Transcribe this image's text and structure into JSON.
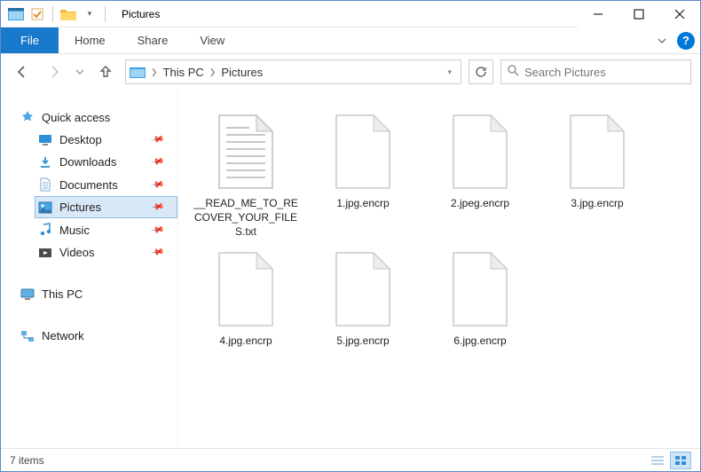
{
  "window": {
    "title": "Pictures"
  },
  "ribbon": {
    "file": "File",
    "tabs": [
      "Home",
      "Share",
      "View"
    ]
  },
  "breadcrumb": {
    "items": [
      "This PC",
      "Pictures"
    ]
  },
  "search": {
    "placeholder": "Search Pictures"
  },
  "sidebar": {
    "quick_access": "Quick access",
    "quick_items": [
      {
        "label": "Desktop",
        "icon": "desktop"
      },
      {
        "label": "Downloads",
        "icon": "downloads"
      },
      {
        "label": "Documents",
        "icon": "documents"
      },
      {
        "label": "Pictures",
        "icon": "pictures",
        "selected": true
      },
      {
        "label": "Music",
        "icon": "music"
      },
      {
        "label": "Videos",
        "icon": "videos"
      }
    ],
    "this_pc": "This PC",
    "network": "Network"
  },
  "files": [
    {
      "name": "__READ_ME_TO_RECOVER_YOUR_FILES.txt",
      "type": "txt"
    },
    {
      "name": "1.jpg.encrp",
      "type": "blank"
    },
    {
      "name": "2.jpeg.encrp",
      "type": "blank"
    },
    {
      "name": "3.jpg.encrp",
      "type": "blank"
    },
    {
      "name": "4.jpg.encrp",
      "type": "blank"
    },
    {
      "name": "5.jpg.encrp",
      "type": "blank"
    },
    {
      "name": "6.jpg.encrp",
      "type": "blank"
    }
  ],
  "status": {
    "count_label": "7 items"
  }
}
